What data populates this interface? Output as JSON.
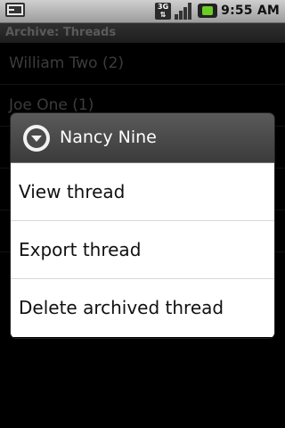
{
  "status_bar": {
    "keyboard_icon": "keyboard-icon",
    "network_label": "3G",
    "signal_icon": "signal-icon",
    "battery_icon": "battery-charging-icon",
    "time": "9:55 AM"
  },
  "title_bar": {
    "title": "Archive: Threads"
  },
  "threads": [
    {
      "label": "William Two (2)"
    },
    {
      "label": "Joe One (1)"
    },
    {
      "label": ""
    },
    {
      "label": ""
    },
    {
      "label": ""
    }
  ],
  "dialog": {
    "title": "Nancy Nine",
    "items": [
      {
        "label": "View thread"
      },
      {
        "label": "Export thread"
      },
      {
        "label": "Delete archived thread"
      }
    ]
  }
}
